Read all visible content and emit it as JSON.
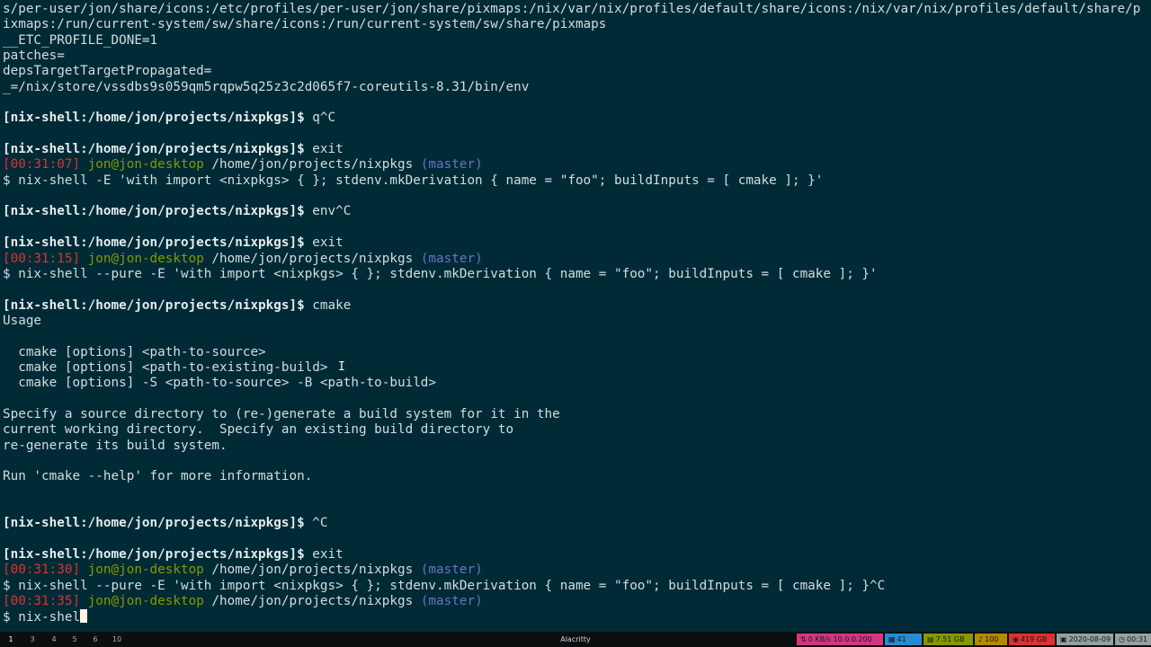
{
  "terminal": {
    "lines": [
      [
        {
          "t": "s/per-user/jon/share/icons:/etc/profiles/per-user/jon/share/pixmaps:/nix/var/nix/profiles/default/share/icons:/nix/var/nix/profiles/default/share/p"
        }
      ],
      [
        {
          "t": "ixmaps:/run/current-system/sw/share/icons:/run/current-system/sw/share/pixmaps"
        }
      ],
      [
        {
          "t": "__ETC_PROFILE_DONE=1"
        }
      ],
      [
        {
          "t": "patches="
        }
      ],
      [
        {
          "t": "depsTargetTargetPropagated="
        }
      ],
      [
        {
          "t": "_=/nix/store/vssdbs9s059qm5rqpw5q25z3c2d065f7-coreutils-8.31/bin/env"
        }
      ],
      [],
      [
        {
          "t": "[nix-shell:/home/jon/projects/nixpkgs]$",
          "c": "prompt"
        },
        {
          "t": " q^C"
        }
      ],
      [],
      [
        {
          "t": "[nix-shell:/home/jon/projects/nixpkgs]$",
          "c": "prompt"
        },
        {
          "t": " exit"
        }
      ],
      [
        {
          "t": "[00:31:07]",
          "c": "c-red"
        },
        {
          "t": " "
        },
        {
          "t": "jon@jon-desktop",
          "c": "c-green"
        },
        {
          "t": " /home/jon/projects/nixpkgs "
        },
        {
          "t": "(master)",
          "c": "c-blue"
        }
      ],
      [
        {
          "t": "$ nix-shell -E 'with import <nixpkgs> { }; stdenv.mkDerivation { name = \"foo\"; buildInputs = [ cmake ]; }'"
        }
      ],
      [],
      [
        {
          "t": "[nix-shell:/home/jon/projects/nixpkgs]$",
          "c": "prompt"
        },
        {
          "t": " env^C"
        }
      ],
      [],
      [
        {
          "t": "[nix-shell:/home/jon/projects/nixpkgs]$",
          "c": "prompt"
        },
        {
          "t": " exit"
        }
      ],
      [
        {
          "t": "[00:31:15]",
          "c": "c-red"
        },
        {
          "t": " "
        },
        {
          "t": "jon@jon-desktop",
          "c": "c-green"
        },
        {
          "t": " /home/jon/projects/nixpkgs "
        },
        {
          "t": "(master)",
          "c": "c-blue"
        }
      ],
      [
        {
          "t": "$ nix-shell --pure -E 'with import <nixpkgs> { }; stdenv.mkDerivation { name = \"foo\"; buildInputs = [ cmake ]; }'"
        }
      ],
      [],
      [
        {
          "t": "[nix-shell:/home/jon/projects/nixpkgs]$",
          "c": "prompt"
        },
        {
          "t": " cmake"
        }
      ],
      [
        {
          "t": "Usage"
        }
      ],
      [],
      [
        {
          "t": "  cmake [options] <path-to-source>"
        }
      ],
      [
        {
          "t": "  cmake [options] <path-to-existing-build>"
        }
      ],
      [
        {
          "t": "  cmake [options] -S <path-to-source> -B <path-to-build>"
        }
      ],
      [],
      [
        {
          "t": "Specify a source directory to (re-)generate a build system for it in the"
        }
      ],
      [
        {
          "t": "current working directory.  Specify an existing build directory to"
        }
      ],
      [
        {
          "t": "re-generate its build system."
        }
      ],
      [],
      [
        {
          "t": "Run 'cmake --help' for more information."
        }
      ],
      [],
      [],
      [
        {
          "t": "[nix-shell:/home/jon/projects/nixpkgs]$",
          "c": "prompt"
        },
        {
          "t": " ^C"
        }
      ],
      [],
      [
        {
          "t": "[nix-shell:/home/jon/projects/nixpkgs]$",
          "c": "prompt"
        },
        {
          "t": " exit"
        }
      ],
      [
        {
          "t": "[00:31:30]",
          "c": "c-red"
        },
        {
          "t": " "
        },
        {
          "t": "jon@jon-desktop",
          "c": "c-green"
        },
        {
          "t": " /home/jon/projects/nixpkgs "
        },
        {
          "t": "(master)",
          "c": "c-blue"
        }
      ],
      [
        {
          "t": "$ nix-shell --pure -E 'with import <nixpkgs> { }; stdenv.mkDerivation { name = \"foo\"; buildInputs = [ cmake ]; }^C"
        }
      ],
      [
        {
          "t": "[00:31:35]",
          "c": "c-red"
        },
        {
          "t": " "
        },
        {
          "t": "jon@jon-desktop",
          "c": "c-green"
        },
        {
          "t": " /home/jon/projects/nixpkgs "
        },
        {
          "t": "(master)",
          "c": "c-blue"
        }
      ],
      [
        {
          "t": "$ nix-shel"
        },
        {
          "cursor": true
        }
      ]
    ]
  },
  "statusbar": {
    "workspaces": [
      "1",
      "3",
      "4",
      "5",
      "6",
      "10"
    ],
    "active_workspace": "1",
    "window_title": "Alacritty",
    "blocks": [
      {
        "label": "0 KB/s 10.0.0.200",
        "bg": "#d33682",
        "fg": "#1a1a1a",
        "icon": "network-icon"
      },
      {
        "label": "41",
        "bg": "#268bd2",
        "fg": "#1a1a1a",
        "icon": "cpu-icon"
      },
      {
        "label": "7.51 GB",
        "bg": "#859900",
        "fg": "#1a1a1a",
        "icon": "memory-icon"
      },
      {
        "label": "100",
        "bg": "#b58900",
        "fg": "#1a1a1a",
        "icon": "volume-icon"
      },
      {
        "label": "419 GB",
        "bg": "#dc322f",
        "fg": "#1a1a1a",
        "icon": "disk-icon"
      },
      {
        "label": "2020-08-09",
        "bg": "#93a1a1",
        "fg": "#1a1a1a",
        "icon": "calendar-icon"
      },
      {
        "label": "00:31",
        "bg": "#93a1a1",
        "fg": "#1a1a1a",
        "icon": "clock-icon"
      }
    ]
  }
}
